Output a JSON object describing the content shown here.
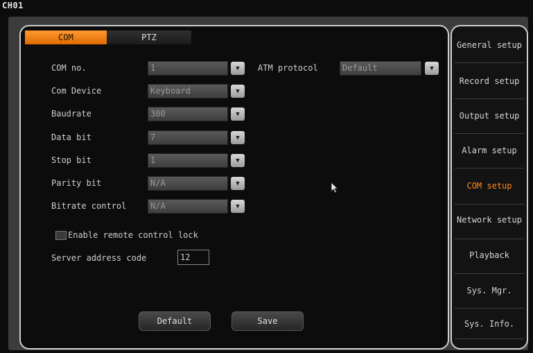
{
  "channel": "CH01",
  "tabs": {
    "com": "COM",
    "ptz": "PTZ"
  },
  "form": {
    "com_no": {
      "label": "COM no.",
      "value": "1"
    },
    "atm_protocol": {
      "label": "ATM protocol",
      "value": "Default"
    },
    "com_device": {
      "label": "Com Device",
      "value": "Keyboard"
    },
    "baudrate": {
      "label": "Baudrate",
      "value": "300"
    },
    "data_bit": {
      "label": "Data bit",
      "value": "7"
    },
    "stop_bit": {
      "label": "Stop bit",
      "value": "1"
    },
    "parity_bit": {
      "label": "Parity bit",
      "value": "N/A"
    },
    "bitrate_control": {
      "label": "Bitrate control",
      "value": "N/A"
    },
    "remote_lock": {
      "label": "Enable remote control lock",
      "checked": false
    },
    "server_address": {
      "label": "Server address code",
      "value": "12"
    }
  },
  "buttons": {
    "default": "Default",
    "save": "Save"
  },
  "sidebar": {
    "items": [
      {
        "label": "General setup",
        "active": false
      },
      {
        "label": "Record setup",
        "active": false
      },
      {
        "label": "Output setup",
        "active": false
      },
      {
        "label": "Alarm setup",
        "active": false
      },
      {
        "label": "COM setup",
        "active": true
      },
      {
        "label": "Network setup",
        "active": false
      },
      {
        "label": "Playback",
        "active": false
      },
      {
        "label": "Sys. Mgr.",
        "active": false
      },
      {
        "label": "Sys. Info.",
        "active": false
      }
    ]
  },
  "colors": {
    "accent": "#ff8a1a",
    "border": "#cfcfcf",
    "background": "#0c0c0c"
  }
}
